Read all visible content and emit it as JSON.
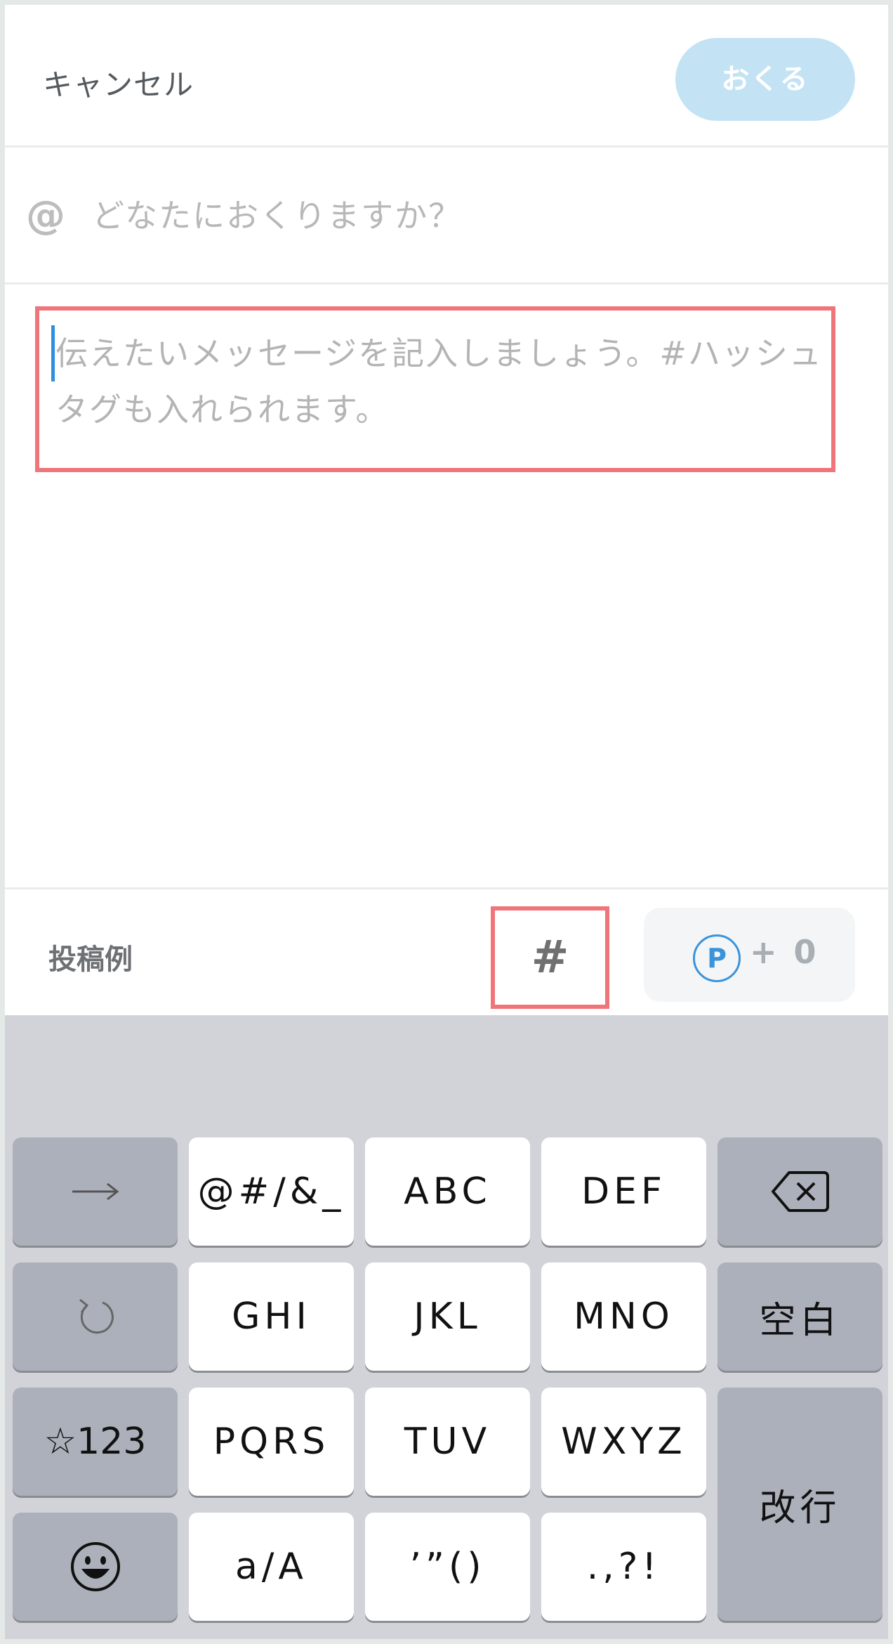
{
  "header": {
    "cancel_label": "キャンセル",
    "send_label": "おくる"
  },
  "recipient": {
    "at_symbol": "@",
    "placeholder": "どなたにおくりますか？"
  },
  "message": {
    "placeholder": "伝えたいメッセージを記入しましょう。#ハッシュタグも入れられます。"
  },
  "bottom_bar": {
    "examples_label": "投稿例",
    "hashtag_label": "#",
    "points_icon": "P",
    "points_value": "+ 0"
  },
  "keyboard": {
    "row1": [
      "@#/&_",
      "ABC",
      "DEF"
    ],
    "row2": [
      "GHI",
      "JKL",
      "MNO",
      "空白"
    ],
    "row3": [
      "☆123",
      "PQRS",
      "TUV",
      "WXYZ",
      "改行"
    ],
    "row4": [
      "a/A",
      "’”()",
      ".,?!"
    ],
    "icons": [
      "arrow-right-icon",
      "backspace-icon",
      "undo-icon",
      "emoji-icon"
    ]
  }
}
